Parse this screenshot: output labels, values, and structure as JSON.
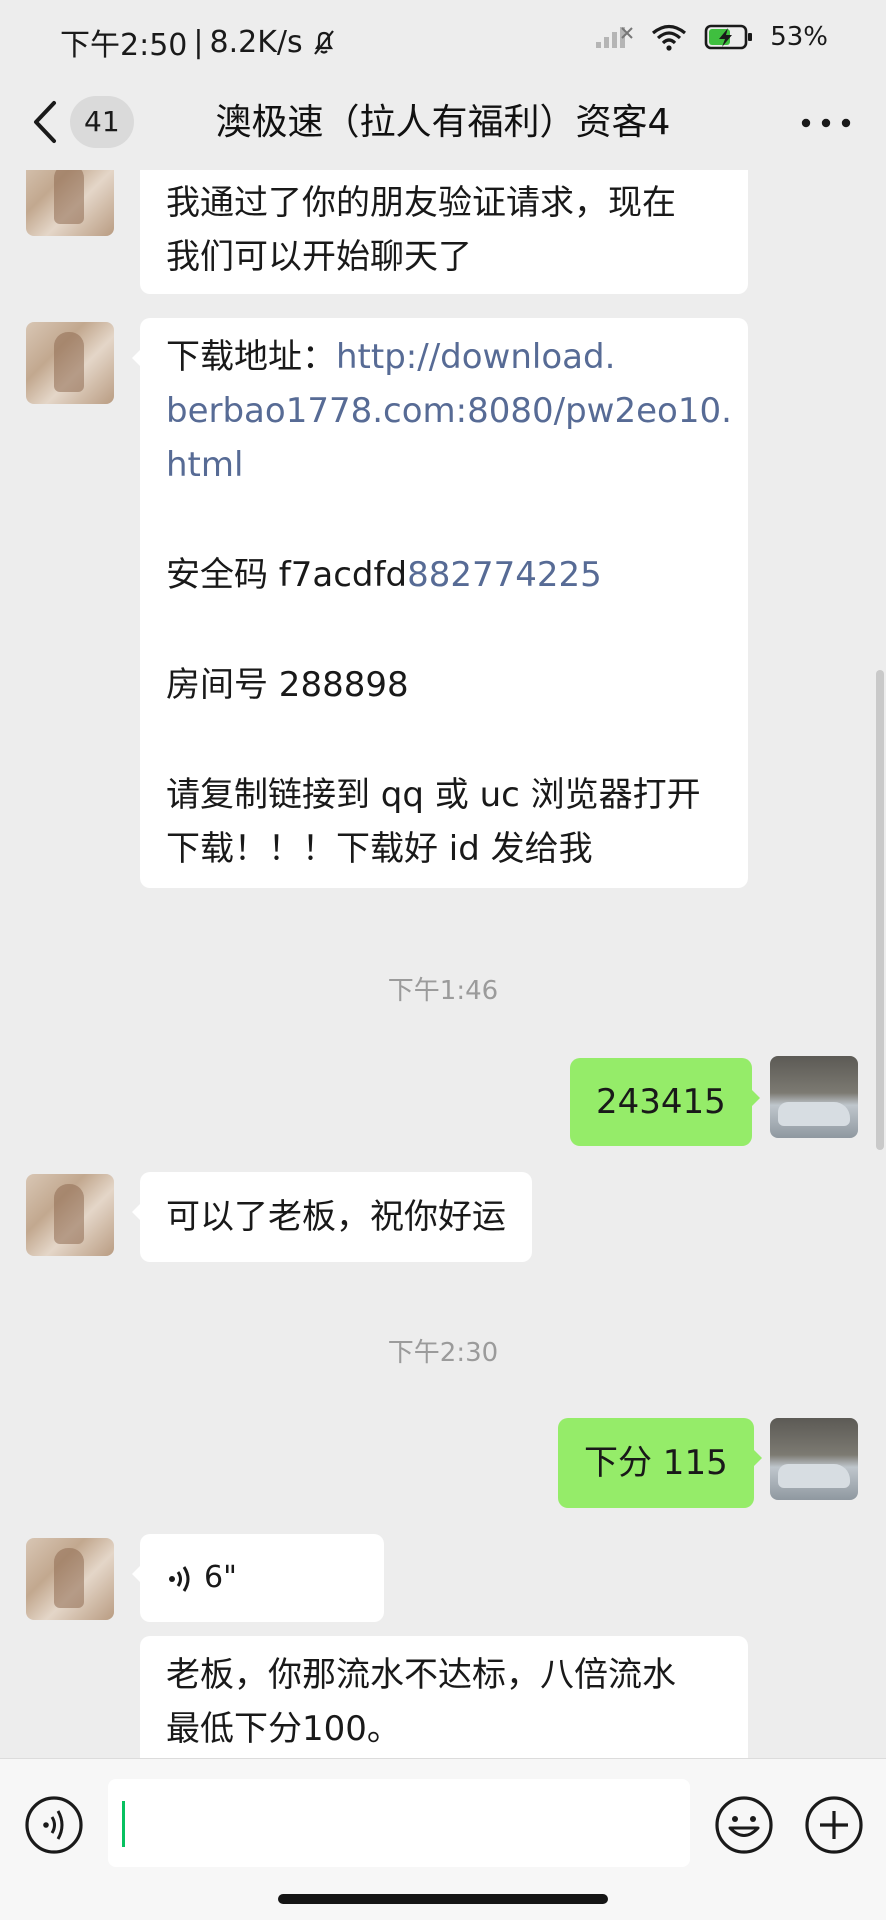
{
  "status_bar": {
    "time": "下午2:50",
    "separator": "|",
    "speed": "8.2K/s",
    "battery_percent": "53%",
    "icons": [
      "mute-bell-icon",
      "signal-icon",
      "wifi-icon",
      "battery-charging-icon"
    ]
  },
  "header": {
    "back_badge": "41",
    "title": "澳极速（拉人有福利）资客4",
    "icons": [
      "back-chevron-icon",
      "more-dots-icon"
    ]
  },
  "messages": [
    {
      "side": "left",
      "text_lines": [
        "我通过了你的朋友验证请求，现在",
        "我们可以开始聊天了"
      ]
    },
    {
      "side": "left",
      "download_label": "下载地址：",
      "download_link_lines": [
        "http://download.",
        "berbao1778.com:8080/pw2eo10.",
        "html"
      ],
      "security_label": "安全码 f7acdfd",
      "security_number": "882774225",
      "room": "房间号 288898",
      "instruction_lines": [
        "请复制链接到 qq 或 uc 浏览器打开",
        "下载！！！下载好 id 发给我"
      ]
    },
    {
      "time": "下午1:46"
    },
    {
      "side": "right",
      "text": "243415"
    },
    {
      "side": "left",
      "text": "可以了老板，祝你好运"
    },
    {
      "time": "下午2:30"
    },
    {
      "side": "right",
      "text": "下分 115"
    },
    {
      "side": "left",
      "voice_duration": "6\""
    },
    {
      "side": "left",
      "text_lines": [
        "老板，你那流水不达标，八倍流水",
        "最低下分100。"
      ]
    }
  ],
  "colors": {
    "background": "#ededed",
    "bubble_incoming": "#ffffff",
    "bubble_outgoing": "#95ec69",
    "link": "#576b95",
    "timestamp": "#9b9b9b",
    "cursor": "#07c160"
  },
  "input_bar": {
    "value": "",
    "icons": [
      "voice-input-icon",
      "emoji-icon",
      "plus-icon"
    ]
  }
}
